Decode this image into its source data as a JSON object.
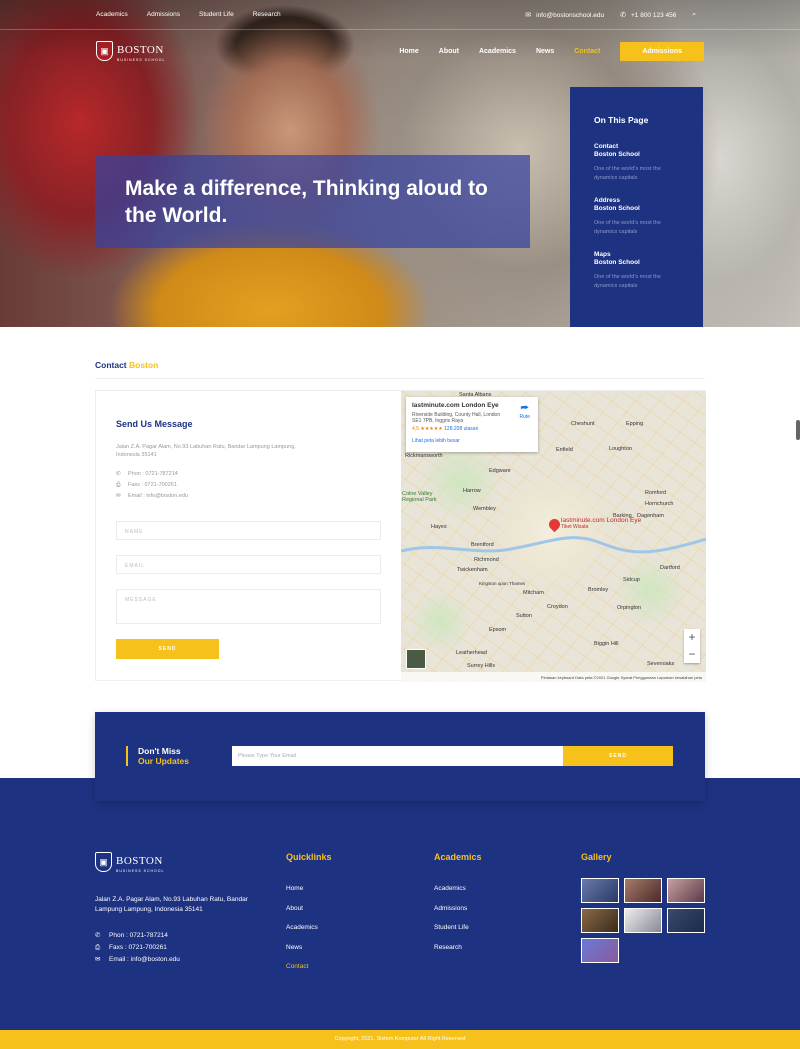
{
  "topbar": {
    "links": [
      "Academics",
      "Admissions",
      "Student Life",
      "Research"
    ],
    "email": "info@bostonschool.edu",
    "phone": "+1 800 123 456"
  },
  "brand": {
    "name": "BOSTON",
    "sub": "BUSINESS SCHOOL"
  },
  "nav": {
    "items": [
      "Home",
      "About",
      "Academics",
      "News",
      "Contact"
    ],
    "active": "Contact",
    "cta": "Admissions"
  },
  "hero": {
    "title": "Make a difference, Thinking aloud to the World."
  },
  "on_this_page": {
    "title": "On This Page",
    "items": [
      {
        "t1": "Contact",
        "t2": "Boston School",
        "desc": "One of the world's most the dynamics capitals"
      },
      {
        "t1": "Address",
        "t2": "Boston School",
        "desc": "One of the world's most the dynamics capitals"
      },
      {
        "t1": "Maps",
        "t2": "Boston School",
        "desc": "One of the world's most the dynamics capitals"
      }
    ]
  },
  "breadcrumb": {
    "a": "Contact",
    "b": "Boston"
  },
  "contact": {
    "title": "Send Us Message",
    "address": "Jalan Z.A. Pagar Alam, No.93 Labuhan Ratu, Bandar Lampung Lampung, Indonesia 35141",
    "phone": "Phon : 0721-787214",
    "fax": "Faxs : 0721-700261",
    "email": "Email : info@boston.edu",
    "ph_name": "NAME",
    "ph_email": "EMAIL",
    "ph_message": "MESSAGE",
    "send": "SEND"
  },
  "map": {
    "popup_title": "lastminute.com London Eye",
    "popup_addr": "Riverside Building, County Hall, London SE1 7PB, Inggris Raya",
    "rating": "4,5 ★★★★★",
    "reviews": "128.208 ulasan",
    "larger": "Lihat peta lebih besar",
    "route": "Rute",
    "pin": "lastminute.com London Eye",
    "pin_sub": "Tiket Wisata",
    "places": [
      "Santa Albans",
      "Cheshunt",
      "Epping",
      "Enfield",
      "Loughton",
      "Edgware",
      "Harrow",
      "Romford",
      "Hornchurch",
      "Wembley",
      "Hayes",
      "Barking",
      "Dagenham",
      "Brentford",
      "Richmond",
      "Twickenham",
      "Dartford",
      "Sidcup",
      "Bromley",
      "Orpington",
      "Croydon",
      "Mitcham",
      "Kingston upon Thames",
      "Sutton",
      "Epsom",
      "Leatherhead",
      "Biggin Hill",
      "Sevenoaks",
      "Colne Valley Regional Park",
      "Rickmansworth",
      "Surrey Hills"
    ],
    "footer": "Pintasan keyboard   Data peta ©2021 Google   Syarat Penggunaan   Laporkan kesalahan peta"
  },
  "subscribe": {
    "l1": "Don't Miss",
    "l2": "Our Updates",
    "placeholder": "Please Type Your Email",
    "send": "SEND"
  },
  "footer": {
    "address": "Jalan Z.A. Pagar Alam, No.93 Labuhan Ratu, Bandar Lampung Lampung, Indonesia 35141",
    "phone": "Phon : 0721-787214",
    "fax": "Faxs : 0721-700261",
    "email": "Email : info@boston.edu",
    "quicklinks": {
      "title": "Quicklinks",
      "items": [
        "Home",
        "About",
        "Academics",
        "News",
        "Contact"
      ]
    },
    "academics": {
      "title": "Academics",
      "items": [
        "Academics",
        "Admissions",
        "Student Life",
        "Research"
      ]
    },
    "gallery": {
      "title": "Gallery"
    }
  },
  "copyright": "Copyright, 2021. Sistem Komputer All Right Reserved",
  "colors": {
    "navy": "#1e3282",
    "yellow": "#f5c11a"
  }
}
